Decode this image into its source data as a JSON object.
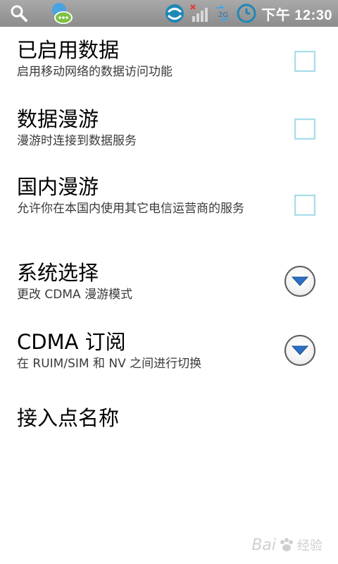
{
  "status_bar": {
    "time": "下午 12:30",
    "icons": [
      "search-icon",
      "chat-bubble-icon",
      "sync-icon",
      "signal-no-sim-icon",
      "data-2g-icon",
      "clock-icon"
    ]
  },
  "preferences": [
    {
      "title": "已启用数据",
      "summary": "启用移动网络的数据访问功能",
      "widget": "checkbox",
      "checked": false
    },
    {
      "title": "数据漫游",
      "summary": "漫游时连接到数据服务",
      "widget": "checkbox",
      "checked": false
    },
    {
      "title": "国内漫游",
      "summary": "允许你在本国内使用其它电信运营商的服务",
      "widget": "checkbox",
      "checked": false
    },
    {
      "title": "系统选择",
      "summary": "更改 CDMA 漫游模式",
      "widget": "dropdown"
    },
    {
      "title": "CDMA 订阅",
      "summary": "在 RUIM/SIM 和 NV 之间进行切换",
      "widget": "dropdown"
    },
    {
      "title": "接入点名称",
      "summary": "",
      "widget": "none"
    }
  ],
  "watermark": {
    "text": "Bai",
    "suffix": "经验"
  },
  "colors": {
    "status_bar": "#999999",
    "checkbox_border": "#a8dde8",
    "dropdown_arrow": "#2a6fc4"
  }
}
